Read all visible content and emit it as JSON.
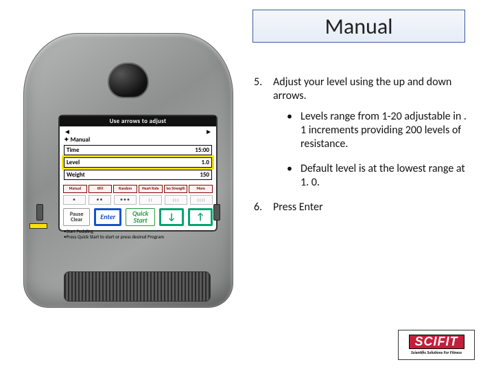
{
  "title": "Manual",
  "steps": [
    {
      "num": "5.",
      "text": "Adjust your level using the up and down arrows."
    },
    {
      "num": "6.",
      "text": "Press Enter"
    }
  ],
  "sub_bullets": [
    "Levels range from 1-20 adjustable in . 1 increments providing 200 levels of resistance.",
    "Default level is at the lowest range at 1. 0."
  ],
  "logo": {
    "brand": "SCIFIT",
    "tagline": "Scientific Solutions For Fitness"
  },
  "console": {
    "header": "Use arrows to adjust",
    "mode": "Manual",
    "rows": [
      {
        "label": "Time",
        "value": "15:00"
      },
      {
        "label": "Level",
        "value": "1.0"
      },
      {
        "label": "Weight",
        "value": "150"
      }
    ],
    "programs": [
      "Manual",
      "IIFit",
      "Random",
      "Heart Rate",
      "Iso Strength",
      "More"
    ],
    "controls": {
      "pause": "Pause Clear",
      "enter": "Enter",
      "quick": "Quick Start",
      "down": "↓",
      "up": "↑"
    },
    "hints": [
      "•Start Pedaling",
      "•Press Quick Start to start or press desired Program"
    ]
  }
}
